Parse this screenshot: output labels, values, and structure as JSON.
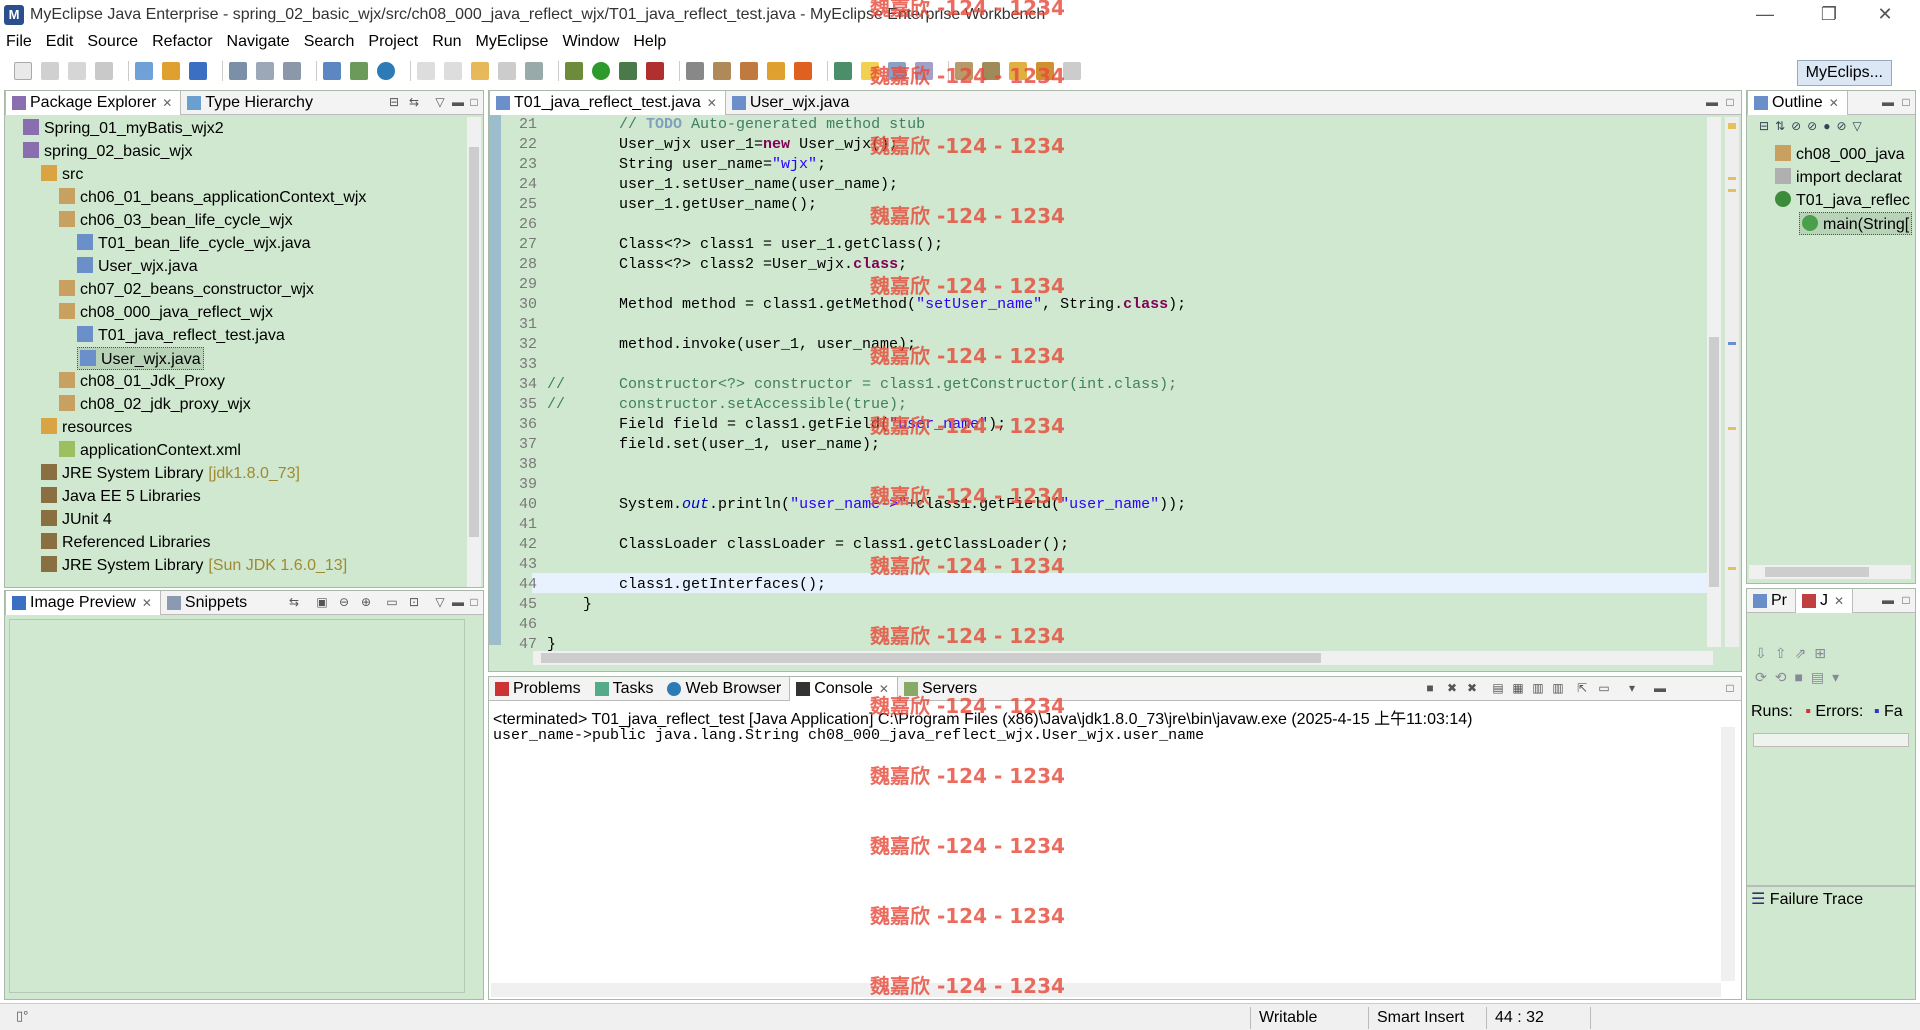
{
  "window": {
    "title": "MyEclipse Java Enterprise - spring_02_basic_wjx/src/ch08_000_java_reflect_wjx/T01_java_reflect_test.java - MyEclipse Enterprise Workbench",
    "minimize": "—",
    "maximize": "❐",
    "close": "✕"
  },
  "menu": [
    "File",
    "Edit",
    "Source",
    "Refactor",
    "Navigate",
    "Search",
    "Project",
    "Run",
    "MyEclipse",
    "Window",
    "Help"
  ],
  "perspective": "MyEclips...",
  "package_explorer": {
    "tabs": [
      "Package Explorer",
      "Type Hierarchy"
    ],
    "items": [
      {
        "label": "Spring_01_myBatis_wjx2",
        "extra": ""
      },
      {
        "label": "spring_02_basic_wjx",
        "extra": ""
      },
      {
        "label": "src",
        "extra": ""
      },
      {
        "label": "ch06_01_beans_applicationContext_wjx",
        "extra": ""
      },
      {
        "label": "ch06_03_bean_life_cycle_wjx",
        "extra": ""
      },
      {
        "label": "T01_bean_life_cycle_wjx.java",
        "extra": ""
      },
      {
        "label": "User_wjx.java",
        "extra": ""
      },
      {
        "label": "ch07_02_beans_constructor_wjx",
        "extra": ""
      },
      {
        "label": "ch08_000_java_reflect_wjx",
        "extra": ""
      },
      {
        "label": "T01_java_reflect_test.java",
        "extra": ""
      },
      {
        "label": "User_wjx.java",
        "extra": ""
      },
      {
        "label": "ch08_01_Jdk_Proxy",
        "extra": ""
      },
      {
        "label": "ch08_02_jdk_proxy_wjx",
        "extra": ""
      },
      {
        "label": "resources",
        "extra": ""
      },
      {
        "label": "applicationContext.xml",
        "extra": ""
      },
      {
        "label": "JRE System Library",
        "extra": "[jdk1.8.0_73]"
      },
      {
        "label": "Java EE 5 Libraries",
        "extra": ""
      },
      {
        "label": "JUnit 4",
        "extra": ""
      },
      {
        "label": "Referenced Libraries",
        "extra": ""
      },
      {
        "label": "JRE System Library",
        "extra": "[Sun JDK 1.6.0_13]"
      }
    ]
  },
  "image_preview": {
    "tabs": [
      "Image Preview",
      "Snippets"
    ]
  },
  "editor": {
    "tabs": [
      "T01_java_reflect_test.java",
      "User_wjx.java"
    ],
    "lines": [
      {
        "n": "21",
        "html": "        <span class=\"cm\">// </span><span class=\"todo\">TODO</span><span class=\"cm\"> Auto-generated method stub</span>"
      },
      {
        "n": "22",
        "html": "        User_wjx user_1=<span class=\"kw\">new</span> User_wjx();"
      },
      {
        "n": "23",
        "html": "        String user_name=<span class=\"str\">\"wjx\"</span>;"
      },
      {
        "n": "24",
        "html": "        user_1.setUser_name(user_name);"
      },
      {
        "n": "25",
        "html": "        user_1.getUser_name();"
      },
      {
        "n": "26",
        "html": ""
      },
      {
        "n": "27",
        "html": "        Class&lt;?&gt; class1 = user_1.getClass();"
      },
      {
        "n": "28",
        "html": "        Class&lt;?&gt; class2 =User_wjx.<span class=\"kw\">class</span>;"
      },
      {
        "n": "29",
        "html": ""
      },
      {
        "n": "30",
        "html": "        Method method = class1.getMethod(<span class=\"str\">\"setUser_name\"</span>, String.<span class=\"kw\">class</span>);"
      },
      {
        "n": "31",
        "html": ""
      },
      {
        "n": "32",
        "html": "        method.invoke(user_1, user_name);"
      },
      {
        "n": "33",
        "html": ""
      },
      {
        "n": "34",
        "html": "<span class=\"cm\">//      Constructor&lt;?&gt; constructor = class1.getConstructor(int.class);</span>"
      },
      {
        "n": "35",
        "html": "<span class=\"cm\">//      constructor.setAccessible(true);</span>"
      },
      {
        "n": "36",
        "html": "        Field field = class1.getField(<span class=\"str\">\"user_name\"</span>);"
      },
      {
        "n": "37",
        "html": "        field.set(user_1, user_name);"
      },
      {
        "n": "38",
        "html": ""
      },
      {
        "n": "39",
        "html": ""
      },
      {
        "n": "40",
        "html": "        System.<span class=\"fld\">out</span>.println(<span class=\"str\">\"user_name-&gt;\"</span>+class1.getField(<span class=\"str\">\"user_name\"</span>));"
      },
      {
        "n": "41",
        "html": ""
      },
      {
        "n": "42",
        "html": "        ClassLoader classLoader = class1.getClassLoader();"
      },
      {
        "n": "43",
        "html": ""
      },
      {
        "n": "44",
        "html": "        class1.getInterfaces();"
      },
      {
        "n": "45",
        "html": "    }"
      },
      {
        "n": "46",
        "html": ""
      },
      {
        "n": "47",
        "html": "}"
      }
    ]
  },
  "outline": {
    "title": "Outline",
    "items": [
      "ch08_000_java",
      "import declarat",
      "T01_java_reflec",
      "main(String["
    ]
  },
  "junit": {
    "tabs": [
      "Pr",
      "J"
    ],
    "runs_label": "Runs:",
    "errors_label": "Errors:",
    "failures_label": "Fa",
    "failure_trace": "Failure Trace"
  },
  "console": {
    "tabs": [
      "Problems",
      "Tasks",
      "Web Browser",
      "Console",
      "Servers"
    ],
    "header": "<terminated> T01_java_reflect_test [Java Application] C:\\Program Files (x86)\\Java\\jdk1.8.0_73\\jre\\bin\\javaw.exe (2025-4-15 上午11:03:14)",
    "output": "user_name->public java.lang.String ch08_000_java_reflect_wjx.User_wjx.user_name"
  },
  "status": {
    "writable": "Writable",
    "insert_mode": "Smart Insert",
    "position": "44 : 32"
  },
  "watermark": "魏嘉欣 -124 - 1234",
  "colors": {
    "editor_bg": "#cfe8cf",
    "current_line": "#e8f2fe",
    "keyword": "#7f0055",
    "string": "#2a00ff",
    "comment": "#3f7f5f",
    "watermark": "#e74c3c"
  }
}
